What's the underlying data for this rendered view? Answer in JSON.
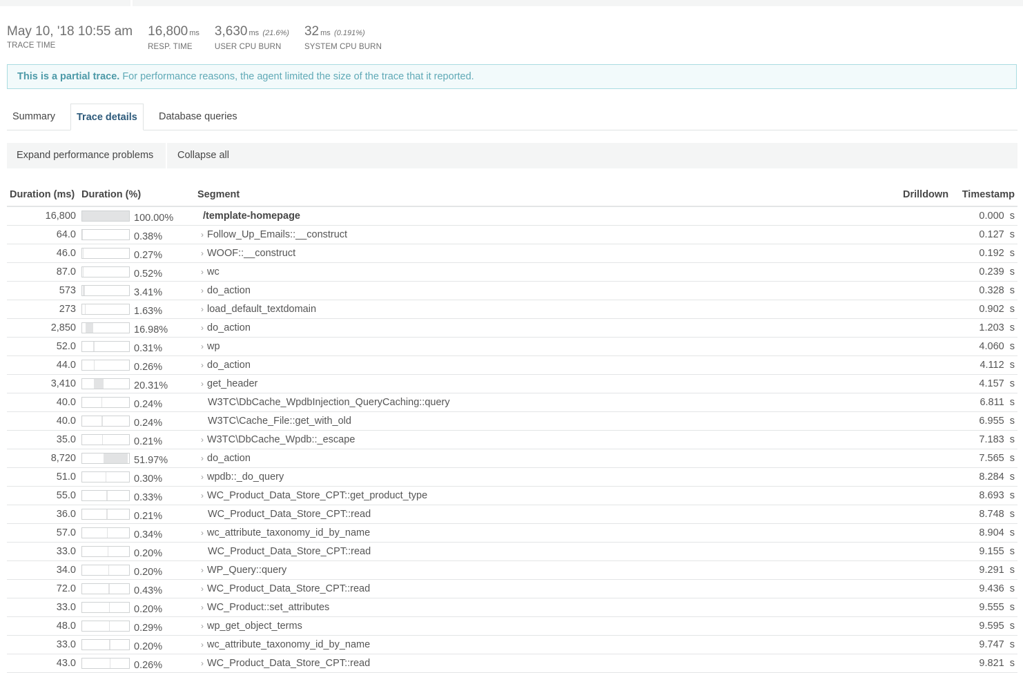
{
  "metrics": [
    {
      "value": "May 10, '18 10:55 am",
      "unit": "",
      "pct": "",
      "label": "TRACE TIME"
    },
    {
      "value": "16,800",
      "unit": "ms",
      "pct": "",
      "label": "RESP. TIME"
    },
    {
      "value": "3,630",
      "unit": "ms",
      "pct": "(21.6%)",
      "label": "USER CPU BURN"
    },
    {
      "value": "32",
      "unit": "ms",
      "pct": "(0.191%)",
      "label": "SYSTEM CPU BURN"
    }
  ],
  "notice": {
    "bold": "This is a partial trace.",
    "text": " For performance reasons, the agent limited the size of the trace that it reported."
  },
  "tabs": [
    {
      "label": "Summary"
    },
    {
      "label": "Trace details"
    },
    {
      "label": "Database queries"
    }
  ],
  "toolbar": {
    "expand_label": "Expand performance problems",
    "collapse_label": "Collapse all"
  },
  "table": {
    "headers": {
      "dur_ms": "Duration (ms)",
      "dur_pct": "Duration (%)",
      "segment": "Segment",
      "drilldown": "Drilldown",
      "timestamp": "Timestamp"
    },
    "rows": [
      {
        "dur": "16,800",
        "pct": "100.00%",
        "frac": 1.0,
        "seg": "/template-homepage",
        "ts": "0.000  s",
        "chev": false,
        "root": true
      },
      {
        "dur": "64.0",
        "pct": "0.38%",
        "frac": 0.0038,
        "seg": "Follow_Up_Emails::__construct",
        "ts": "0.127  s",
        "chev": true,
        "offset": 0.0
      },
      {
        "dur": "46.0",
        "pct": "0.27%",
        "frac": 0.0027,
        "seg": "WOOF::__construct",
        "ts": "0.192  s",
        "chev": true,
        "offset": 0.01
      },
      {
        "dur": "87.0",
        "pct": "0.52%",
        "frac": 0.0052,
        "seg": "wc",
        "ts": "0.239  s",
        "chev": true,
        "offset": 0.014
      },
      {
        "dur": "573",
        "pct": "3.41%",
        "frac": 0.0341,
        "seg": "do_action",
        "ts": "0.328  s",
        "chev": true,
        "offset": 0.02
      },
      {
        "dur": "273",
        "pct": "1.63%",
        "frac": 0.0163,
        "seg": "load_default_textdomain",
        "ts": "0.902  s",
        "chev": true,
        "offset": 0.054
      },
      {
        "dur": "2,850",
        "pct": "16.98%",
        "frac": 0.1698,
        "seg": "do_action",
        "ts": "1.203  s",
        "chev": true,
        "offset": 0.072
      },
      {
        "dur": "52.0",
        "pct": "0.31%",
        "frac": 0.0031,
        "seg": "wp",
        "ts": "4.060  s",
        "chev": true,
        "offset": 0.242
      },
      {
        "dur": "44.0",
        "pct": "0.26%",
        "frac": 0.0026,
        "seg": "do_action",
        "ts": "4.112  s",
        "chev": true,
        "offset": 0.245
      },
      {
        "dur": "3,410",
        "pct": "20.31%",
        "frac": 0.2031,
        "seg": "get_header",
        "ts": "4.157  s",
        "chev": true,
        "offset": 0.247
      },
      {
        "dur": "40.0",
        "pct": "0.24%",
        "frac": 0.0024,
        "seg": "W3TC\\DbCache_WpdbInjection_QueryCaching::query",
        "ts": "6.811  s",
        "chev": false,
        "offset": 0.405
      },
      {
        "dur": "40.0",
        "pct": "0.24%",
        "frac": 0.0024,
        "seg": "W3TC\\Cache_File::get_with_old",
        "ts": "6.955  s",
        "chev": false,
        "offset": 0.414
      },
      {
        "dur": "35.0",
        "pct": "0.21%",
        "frac": 0.0021,
        "seg": "W3TC\\DbCache_Wpdb::_escape",
        "ts": "7.183  s",
        "chev": true,
        "offset": 0.428
      },
      {
        "dur": "8,720",
        "pct": "51.97%",
        "frac": 0.5197,
        "seg": "do_action",
        "ts": "7.565  s",
        "chev": true,
        "offset": 0.45
      },
      {
        "dur": "51.0",
        "pct": "0.30%",
        "frac": 0.003,
        "seg": "wpdb::_do_query",
        "ts": "8.284  s",
        "chev": true,
        "offset": 0.493
      },
      {
        "dur": "55.0",
        "pct": "0.33%",
        "frac": 0.0033,
        "seg": "WC_Product_Data_Store_CPT::get_product_type",
        "ts": "8.693  s",
        "chev": true,
        "offset": 0.517
      },
      {
        "dur": "36.0",
        "pct": "0.21%",
        "frac": 0.0021,
        "seg": "WC_Product_Data_Store_CPT::read",
        "ts": "8.748  s",
        "chev": false,
        "offset": 0.521
      },
      {
        "dur": "57.0",
        "pct": "0.34%",
        "frac": 0.0034,
        "seg": "wc_attribute_taxonomy_id_by_name",
        "ts": "8.904  s",
        "chev": true,
        "offset": 0.53
      },
      {
        "dur": "33.0",
        "pct": "0.20%",
        "frac": 0.002,
        "seg": "WC_Product_Data_Store_CPT::read",
        "ts": "9.155  s",
        "chev": false,
        "offset": 0.545
      },
      {
        "dur": "34.0",
        "pct": "0.20%",
        "frac": 0.002,
        "seg": "WP_Query::query",
        "ts": "9.291  s",
        "chev": true,
        "offset": 0.553
      },
      {
        "dur": "72.0",
        "pct": "0.43%",
        "frac": 0.0043,
        "seg": "WC_Product_Data_Store_CPT::read",
        "ts": "9.436  s",
        "chev": true,
        "offset": 0.562
      },
      {
        "dur": "33.0",
        "pct": "0.20%",
        "frac": 0.002,
        "seg": "WC_Product::set_attributes",
        "ts": "9.555  s",
        "chev": true,
        "offset": 0.569
      },
      {
        "dur": "48.0",
        "pct": "0.29%",
        "frac": 0.0029,
        "seg": "wp_get_object_terms",
        "ts": "9.595  s",
        "chev": true,
        "offset": 0.571
      },
      {
        "dur": "33.0",
        "pct": "0.20%",
        "frac": 0.002,
        "seg": "wc_attribute_taxonomy_id_by_name",
        "ts": "9.747  s",
        "chev": true,
        "offset": 0.58
      },
      {
        "dur": "43.0",
        "pct": "0.26%",
        "frac": 0.0026,
        "seg": "WC_Product_Data_Store_CPT::read",
        "ts": "9.821  s",
        "chev": true,
        "offset": 0.585
      }
    ]
  }
}
